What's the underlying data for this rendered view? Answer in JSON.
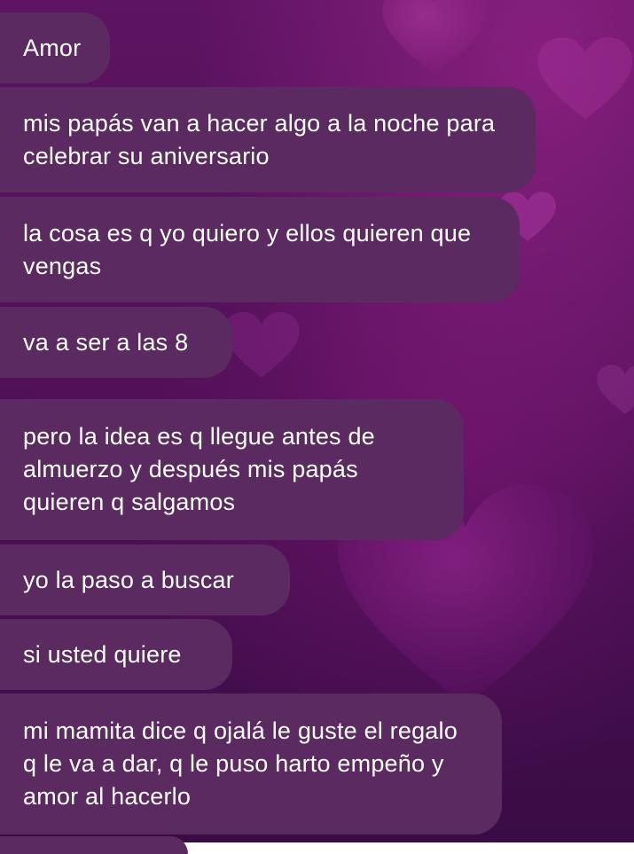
{
  "background": {
    "base_color": "#4e1157",
    "accent_color": "#b02a9a",
    "bubble_color": "#5a2a60",
    "text_color": "#ffffff",
    "decoration": "heart-pattern"
  },
  "messages": [
    {
      "text": "Amor"
    },
    {
      "text": "mis papás van a hacer algo a la noche para celebrar su aniversario"
    },
    {
      "text": "la cosa es q yo quiero y ellos quieren que vengas"
    },
    {
      "text": "va a ser a las 8"
    },
    {
      "text": "pero la idea es q llegue antes de almuerzo y después mis papás quieren q salgamos"
    },
    {
      "text": "yo la paso a buscar"
    },
    {
      "text": "si usted quiere"
    },
    {
      "text": "mi mamita dice q ojalá le guste el regalo q le va a dar, q le puso harto empeño y amor al hacerlo"
    }
  ]
}
